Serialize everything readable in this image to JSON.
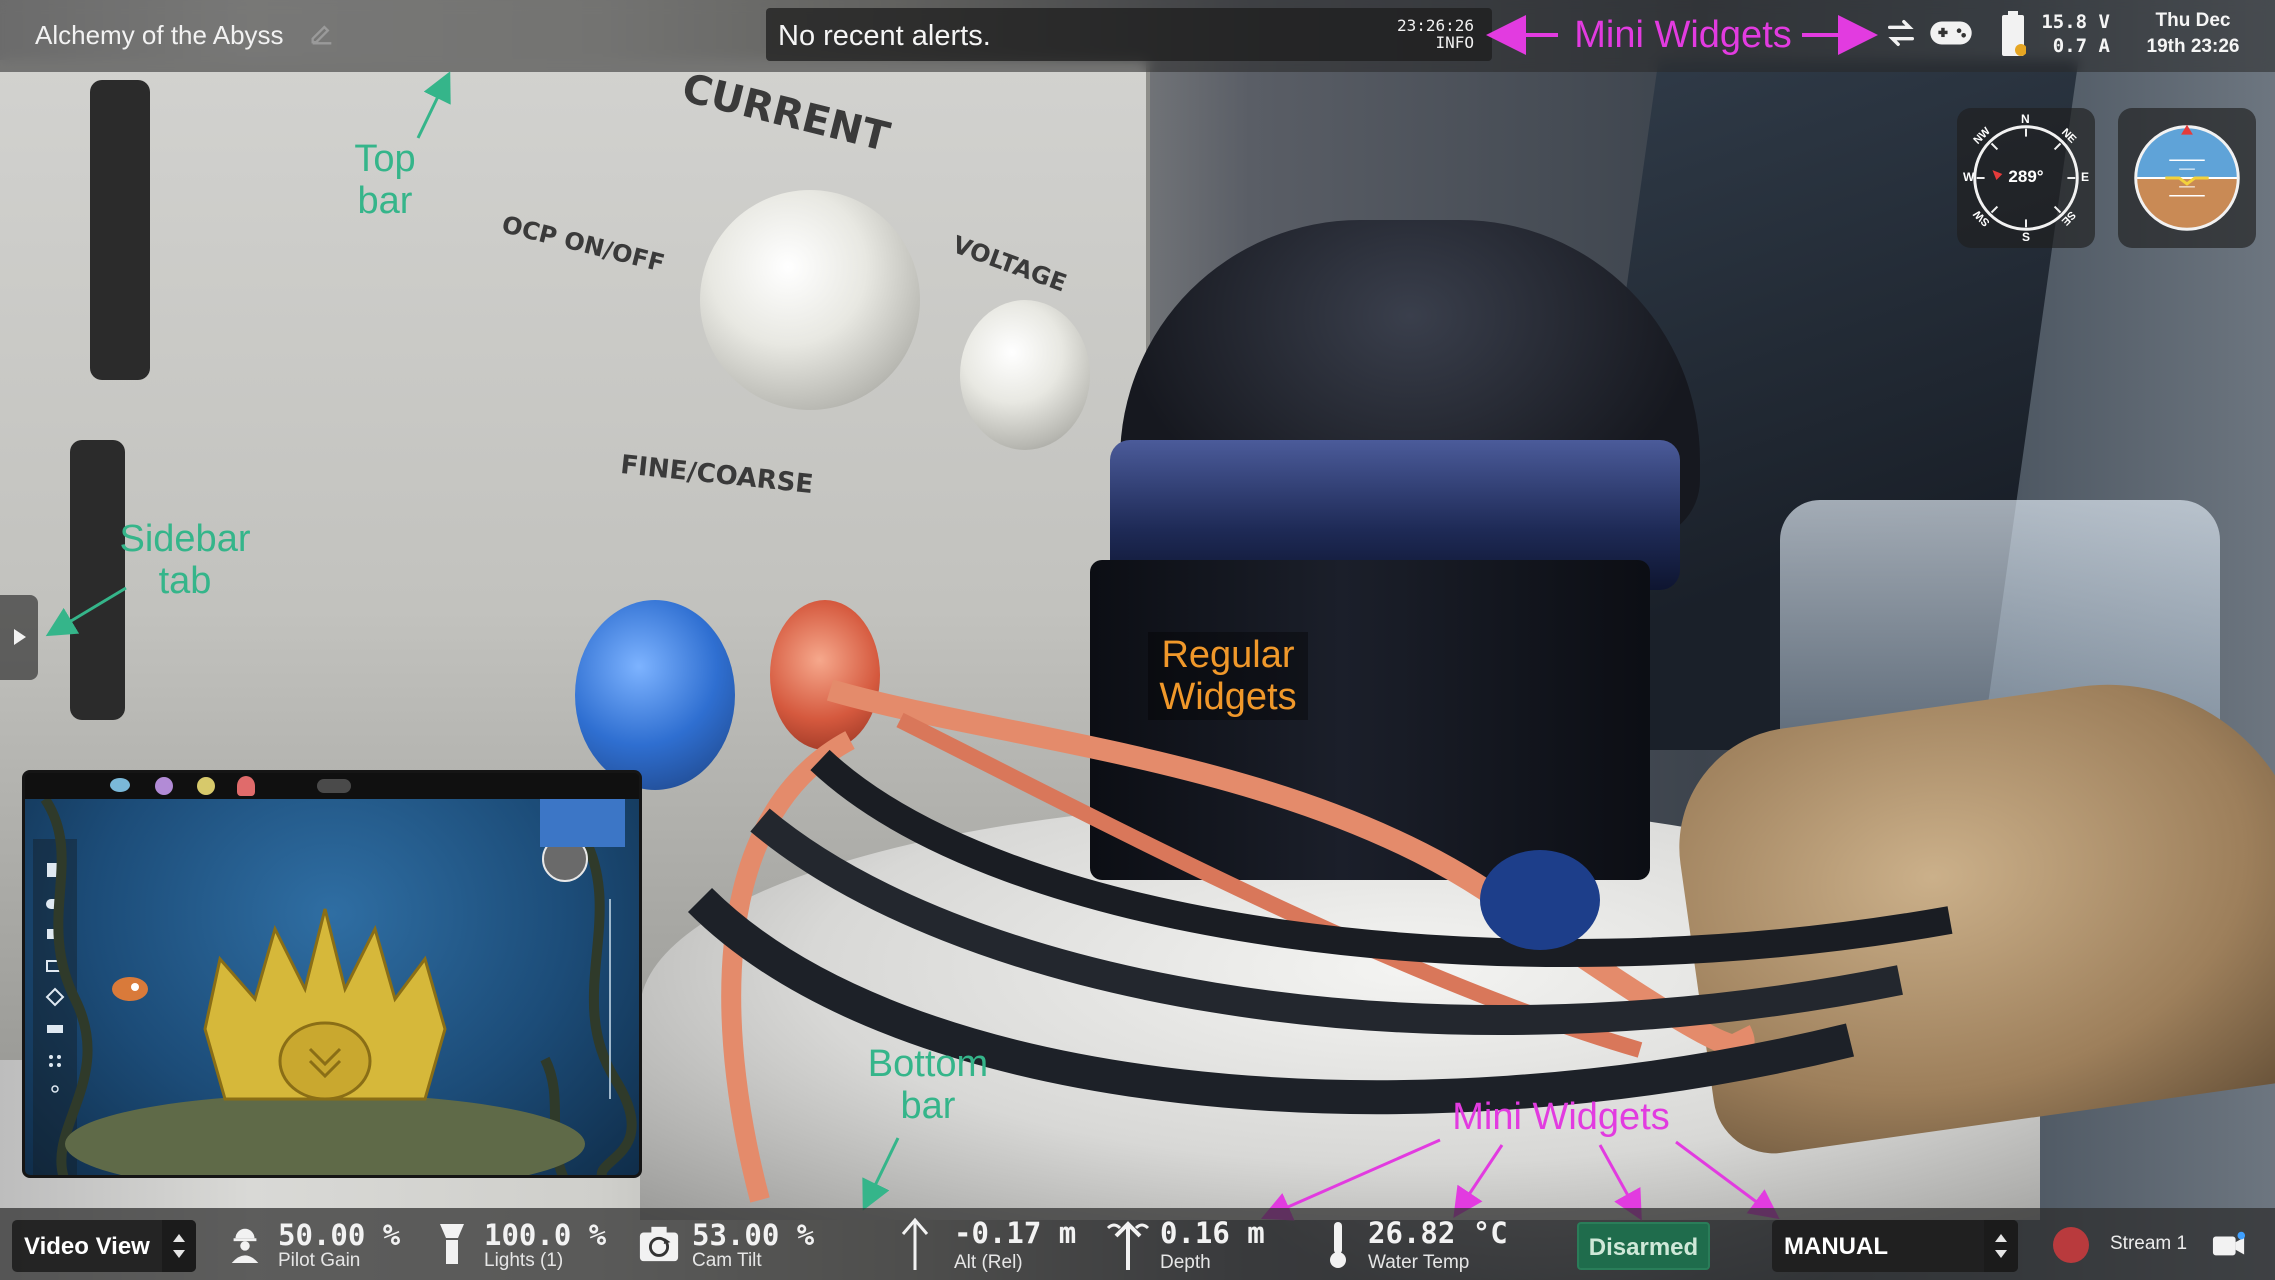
{
  "top_bar": {
    "mission_name": "Alchemy of the Abyss",
    "alert_text": "No recent alerts.",
    "alert_time": "23:26:26",
    "alert_level": "INFO",
    "battery_voltage": "15.8 V",
    "battery_current": "0.7 A",
    "clock_day": "Thu Dec",
    "clock_time": "19th 23:26",
    "icons": [
      "edit-icon",
      "swap-arrows-icon",
      "gamepad-icon",
      "battery-icon"
    ]
  },
  "compass": {
    "heading": "289°",
    "cardinals": [
      "N",
      "NE",
      "E",
      "SE",
      "S",
      "SW",
      "W",
      "NW"
    ]
  },
  "annotations": {
    "top_bar_line1": "Top",
    "top_bar_line2": "bar",
    "sidebar_tab_line1": "Sidebar",
    "sidebar_tab_line2": "tab",
    "regular_widgets_line1": "Regular",
    "regular_widgets_line2": "Widgets",
    "bottom_bar_line1": "Bottom",
    "bottom_bar_line2": "bar",
    "mini_widgets_top": "Mini Widgets",
    "mini_widgets_bottom": "Mini Widgets"
  },
  "bottom_bar": {
    "view_select": "Video View",
    "pilot_gain": {
      "value": "50.00 %",
      "label": "Pilot Gain"
    },
    "lights": {
      "value": "100.0 %",
      "label": "Lights (1)"
    },
    "cam_tilt": {
      "value": "53.00 %",
      "label": "Cam Tilt"
    },
    "altitude": {
      "value": "-0.17 m",
      "label": "Alt (Rel)"
    },
    "depth": {
      "value": "0.16 m",
      "label": "Depth"
    },
    "water_temp": {
      "value": "26.82 °C",
      "label": "Water Temp"
    },
    "arm_state": "Disarmed",
    "flight_mode": "MANUAL",
    "stream": "Stream 1"
  },
  "colors": {
    "annotation_green": "#35b58a",
    "annotation_magenta": "#e23be0",
    "annotation_orange": "#f0982a",
    "disarmed_green": "#1f6c4c",
    "record_red": "#b93a3d"
  }
}
